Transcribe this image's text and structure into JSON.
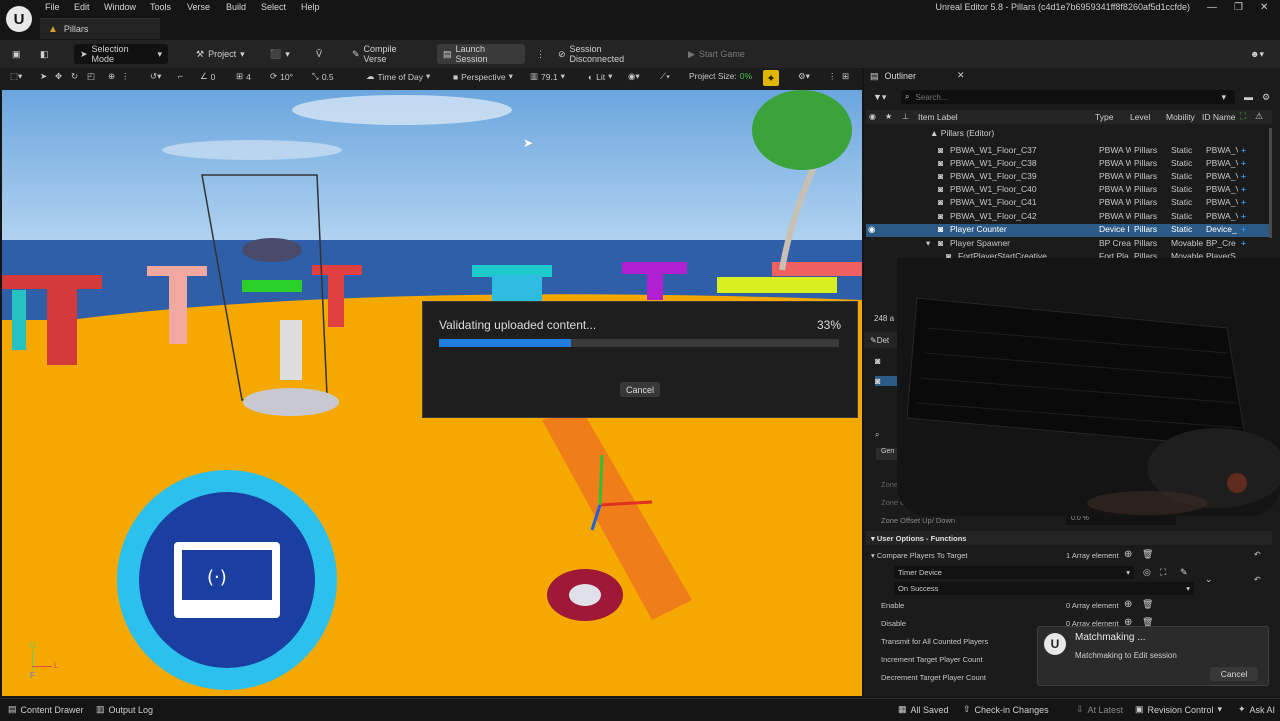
{
  "window": {
    "title": "Unreal Editor 5.8 - Pillars (c4d1e7b6959341ff8f8260af5d1ccfde)",
    "tab": "Pillars",
    "menu": [
      "File",
      "Edit",
      "Window",
      "Tools",
      "Verse",
      "Build",
      "Select",
      "Help"
    ]
  },
  "toolbar": {
    "selection_mode": "Selection Mode",
    "project": "Project",
    "compile_verse": "Compile Verse",
    "launch_session": "Launch Session",
    "session_status": "Session Disconnected",
    "start_game": "Start Game"
  },
  "viewport_toolbar": {
    "snap_count": "0",
    "grid": "4",
    "rotate": "10°",
    "scale": "0.5",
    "time_of_day": "Time of Day",
    "perspective": "Perspective",
    "fov": "79.1",
    "lit": "Lit",
    "project_size_label": "Project Size:",
    "project_size_value": "0%"
  },
  "dialog": {
    "message": "Validating uploaded content...",
    "percent": "33%",
    "progress": 0.33,
    "cancel": "Cancel"
  },
  "viewport_overlay": {
    "axis_up": "U",
    "axis_left": "L",
    "axis_f": "F"
  },
  "outliner": {
    "tab": "Outliner",
    "search_placeholder": "Search...",
    "columns": [
      "Item Label",
      "Type",
      "Level",
      "Mobility",
      "ID Name"
    ],
    "root": "Pillars (Editor)",
    "rows": [
      {
        "label": "PBWA_W1_Floor_C37",
        "type": "PBWA W",
        "level": "Pillars",
        "mobility": "Static",
        "id": "PBWA_V"
      },
      {
        "label": "PBWA_W1_Floor_C38",
        "type": "PBWA W",
        "level": "Pillars",
        "mobility": "Static",
        "id": "PBWA_V"
      },
      {
        "label": "PBWA_W1_Floor_C39",
        "type": "PBWA W",
        "level": "Pillars",
        "mobility": "Static",
        "id": "PBWA_V"
      },
      {
        "label": "PBWA_W1_Floor_C40",
        "type": "PBWA W",
        "level": "Pillars",
        "mobility": "Static",
        "id": "PBWA_V"
      },
      {
        "label": "PBWA_W1_Floor_C41",
        "type": "PBWA W",
        "level": "Pillars",
        "mobility": "Static",
        "id": "PBWA_V"
      },
      {
        "label": "PBWA_W1_Floor_C42",
        "type": "PBWA W",
        "level": "Pillars",
        "mobility": "Static",
        "id": "PBWA_V"
      },
      {
        "label": "Player Counter",
        "type": "Device I",
        "level": "Pillars",
        "mobility": "Static",
        "id": "Device_"
      },
      {
        "label": "Player Spawner",
        "type": "BP Crea",
        "level": "Pillars",
        "mobility": "Movable",
        "id": "BP_Cre"
      },
      {
        "label": "FortPlayerStartCreative",
        "type": "Fort Pla",
        "level": "Pillars",
        "mobility": "Movable",
        "id": "PlayerS"
      }
    ],
    "count": "248 a"
  },
  "details": {
    "tab": "Det",
    "gen": "Gen",
    "rows_faded": [
      "Zone L",
      "Zone Offset"
    ],
    "zone_offset_label": "Zone Offset Up/ Down",
    "zone_offset_value": "0.0 %",
    "section": "User Options - Functions",
    "compare_label": "Compare Players To Target",
    "compare_value": "1 Array element",
    "timer_device": "Timer Device",
    "on_success": "On Success",
    "enable_label": "Enable",
    "enable_value": "0 Array element",
    "disable_label": "Disable",
    "disable_value": "0 Array element",
    "transmit_label": "Transmit for All Counted Players",
    "increment_label": "Increment Target Player Count",
    "decrement_label": "Decrement Target Player Count"
  },
  "toast": {
    "title": "Matchmaking ...",
    "body": "Matchmaking to Edit session",
    "cancel": "Cancel"
  },
  "statusbar": {
    "content_drawer": "Content Drawer",
    "output_log": "Output Log",
    "all_saved": "All Saved",
    "check_in": "Check-in Changes",
    "at_latest": "At Latest",
    "revision_control": "Revision Control",
    "ask_ai": "Ask AI"
  },
  "colors": {
    "accent": "#1f7fe0",
    "selection": "#2c5a86",
    "warning_badge": "#e0b800",
    "floor": "#f5a800",
    "sea": "#2e5fa8"
  }
}
